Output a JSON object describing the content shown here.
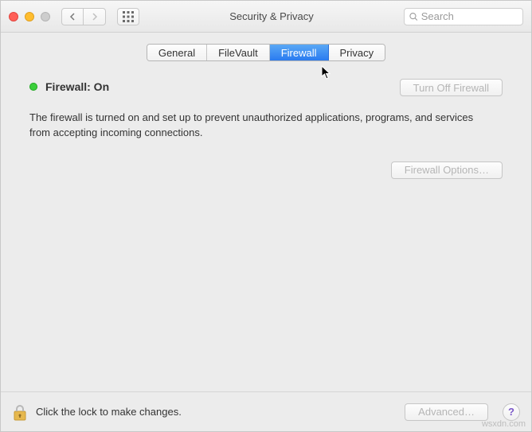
{
  "window": {
    "title": "Security & Privacy",
    "search_placeholder": "Search"
  },
  "tabs": {
    "items": [
      {
        "label": "General"
      },
      {
        "label": "FileVault"
      },
      {
        "label": "Firewall"
      },
      {
        "label": "Privacy"
      }
    ],
    "active_index": 2
  },
  "status": {
    "label": "Firewall: On",
    "color": "#3bcf3b"
  },
  "buttons": {
    "turn_off": "Turn Off Firewall",
    "options": "Firewall Options…",
    "advanced": "Advanced…"
  },
  "description": "The firewall is turned on and set up to prevent unauthorized applications, programs, and services from accepting incoming connections.",
  "footer": {
    "lock_text": "Click the lock to make changes."
  },
  "watermark": "wsxdn.com"
}
